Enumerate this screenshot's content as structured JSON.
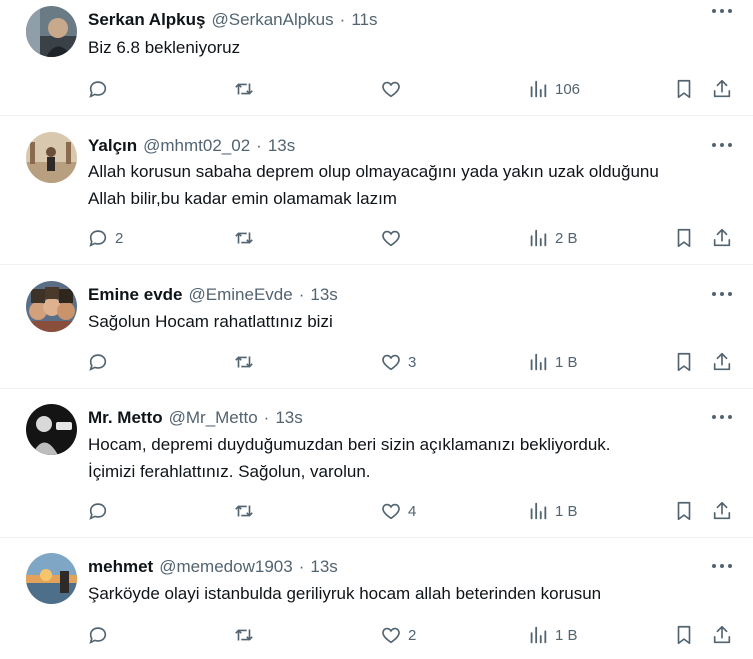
{
  "tweets": [
    {
      "name": "Serkan Alpkuş",
      "handle": "@SerkanAlpkus",
      "time": "11s",
      "text": [
        "Biz 6.8 bekleniyoruz"
      ],
      "replies": "",
      "likes": "",
      "views": "106"
    },
    {
      "name": "Yalçın",
      "handle": "@mhmt02_02",
      "time": "13s",
      "text": [
        "Allah korusun sabaha deprem olup olmayacağını yada yakın uzak olduğunu",
        "Allah bilir,bu kadar emin olamamak lazım"
      ],
      "replies": "2",
      "likes": "",
      "views": "2 B"
    },
    {
      "name": "Emine evde",
      "handle": "@EmineEvde",
      "time": "13s",
      "text": [
        "Sağolun Hocam rahatlattınız bizi"
      ],
      "replies": "",
      "likes": "3",
      "views": "1 B"
    },
    {
      "name": "Mr. Metto",
      "handle": "@Mr_Metto",
      "time": "13s",
      "text": [
        "Hocam, depremi duyduğumuzdan beri sizin açıklamanızı bekliyorduk.",
        "İçimizi ferahlattınız. Sağolun, varolun."
      ],
      "replies": "",
      "likes": "4",
      "views": "1 B"
    },
    {
      "name": "mehmet",
      "handle": "@memedow1903",
      "time": "13s",
      "text": [
        "Şarköyde olayi istanbulda geriliyruk hocam allah beterinden korusun"
      ],
      "replies": "",
      "likes": "2",
      "views": "1 B"
    }
  ],
  "separator": "·",
  "icons": [
    "reply-icon",
    "retweet-icon",
    "like-icon",
    "views-icon",
    "bookmark-icon",
    "share-icon",
    "more-icon"
  ],
  "colors": {
    "text": "#0f1419",
    "secondary": "#536471",
    "divider": "#eff3f4"
  }
}
